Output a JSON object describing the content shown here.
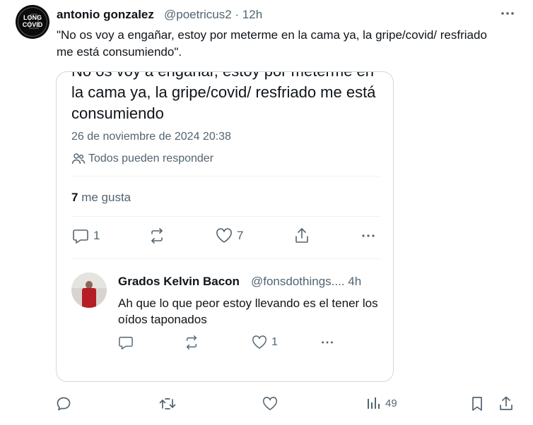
{
  "tweet": {
    "avatar": {
      "line1": "LONG",
      "line2": "COVID"
    },
    "author_name": "antonio gonzalez",
    "author_meta": "@poetricus2 · 12h",
    "text": "\"No os voy a engañar, estoy por meterme en la cama ya, la gripe/covid/ resfriado me está consumiendo\".",
    "more_icon": "more-horizontal-icon"
  },
  "quoted": {
    "text": "No os voy a engañar, estoy por meterme en la cama ya, la gripe/covid/ resfriado me está consumiendo",
    "date": "26 de noviembre de 2024 20:38",
    "reply_setting": "Todos pueden responder",
    "likes_count": "7",
    "likes_label": " me gusta",
    "actions": {
      "replies": "1",
      "likes": "7"
    },
    "reply": {
      "author_name": "Grados Kelvin Bacon",
      "author_meta": "@fonsdothings.... 4h",
      "text": "Ah que lo que peor estoy llevando es el tener los oídos taponados",
      "likes": "1"
    }
  },
  "bottom_actions": {
    "views": "49"
  },
  "colors": {
    "text": "#0f1419",
    "muted": "#536471",
    "border": "#cfd9de"
  }
}
